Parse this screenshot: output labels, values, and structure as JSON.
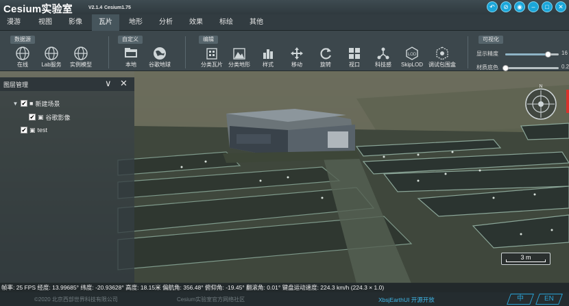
{
  "app": {
    "title": "Cesium实验室",
    "version": "V2.1.4",
    "cesium_version": "Cesium1.75"
  },
  "window_buttons": [
    {
      "name": "back-icon",
      "glyph": "↶"
    },
    {
      "name": "link-icon",
      "glyph": "⊘"
    },
    {
      "name": "globe-icon",
      "glyph": "◉"
    },
    {
      "name": "minimize-icon",
      "glyph": "–"
    },
    {
      "name": "maximize-icon",
      "glyph": "□"
    },
    {
      "name": "close-icon",
      "glyph": "✕"
    }
  ],
  "menu": [
    "漫游",
    "视图",
    "影像",
    "瓦片",
    "地形",
    "分析",
    "效果",
    "标绘",
    "其他"
  ],
  "menu_active": "瓦片",
  "ribbon": {
    "groups": {
      "datasource": "数据源",
      "custom": "自定义",
      "edit": "编辑",
      "visual": "可视化"
    },
    "tools": {
      "online": "在线",
      "lab_service": "Lab服务",
      "instance_model": "实例模型",
      "local": "本地",
      "google_earth": "谷歌地球",
      "classify_tile": "分类瓦片",
      "classify_terrain": "分类地形",
      "style": "样式",
      "move": "移动",
      "rotate": "旋转",
      "viewport": "视口",
      "tech_cut": "科技感",
      "skip_lod": "SkipLOD",
      "debug_bbox": "调试包围盒"
    },
    "sliders": {
      "precision_label": "显示精度",
      "precision_value": "16",
      "precision_fraction": 0.8,
      "bottom_label": "材质底色",
      "bottom_value": "0.2",
      "bottom_fraction": 0.0
    }
  },
  "layer_panel": {
    "title": "图层管理",
    "collapse_glyph": "∨",
    "close_glyph": "✕",
    "nodes": {
      "scene": "新建场景",
      "google_imagery": "谷歌影像",
      "test": "test"
    },
    "check_glyph": "✔"
  },
  "compass": {
    "north": "N"
  },
  "scale": {
    "label": "3 m"
  },
  "status": "帧率: 25 FPS 经度: 13.99685° 纬度: -20.93628° 高度: 18.15米 偏航角: 356.48° 俯仰角: -19.45° 翻滚角: 0.01° 键盘运动速度: 224.3 km/h (224.3 × 1.0)",
  "footer": {
    "copyright": "©2020 北京西部世界科技有限公司",
    "community": "Cesium实验室官方网络社区",
    "opensource": "XbsjEarthUI 开源开放",
    "btn_cn": "中",
    "btn_en": "EN"
  },
  "colors": {
    "accent": "#1aa6d9",
    "link": "#3fb7e8",
    "marker": "#d9322b"
  }
}
